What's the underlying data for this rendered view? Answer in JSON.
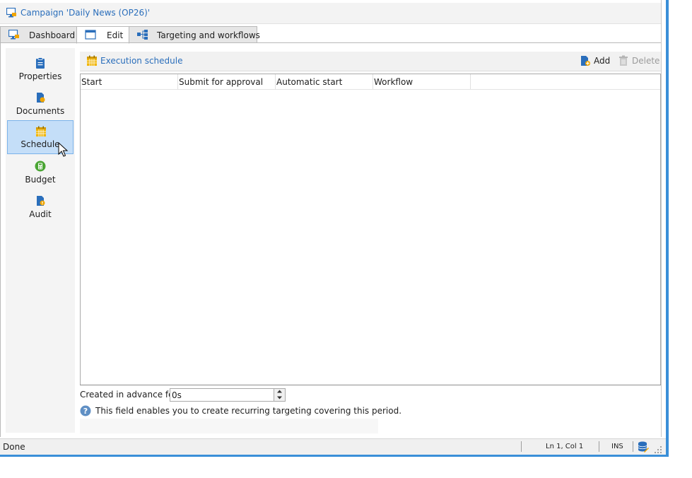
{
  "window": {
    "title": "Campaign 'Daily News (OP26)'"
  },
  "tabs": [
    {
      "label": "Dashboard",
      "icon": "dashboard-icon",
      "active": false
    },
    {
      "label": "Edit",
      "icon": "edit-window-icon",
      "active": true
    },
    {
      "label": "Targeting and workflows",
      "icon": "workflow-icon",
      "active": false
    }
  ],
  "nav": {
    "items": [
      {
        "label": "Properties",
        "icon": "clipboard-icon",
        "active": false
      },
      {
        "label": "Documents",
        "icon": "documents-icon",
        "active": false
      },
      {
        "label": "Schedule",
        "icon": "calendar-icon",
        "active": true
      },
      {
        "label": "Budget",
        "icon": "calculator-icon",
        "active": false
      },
      {
        "label": "Audit",
        "icon": "audit-icon",
        "active": false
      }
    ]
  },
  "toolbar": {
    "title": "Execution schedule",
    "add_label": "Add",
    "delete_label": "Delete"
  },
  "grid": {
    "columns": [
      "Start",
      "Submit for approval",
      "Automatic start",
      "Workflow"
    ],
    "rows": []
  },
  "advance": {
    "label": "Created in advance for:",
    "value": "0s",
    "help": "This field enables you to create recurring targeting covering this period."
  },
  "status": {
    "text": "Done",
    "position": "Ln 1, Col 1",
    "mode": "INS"
  },
  "colors": {
    "accent": "#2a6ebb",
    "nav_selected": "#c4def8",
    "window_border": "#3a8fd8"
  }
}
